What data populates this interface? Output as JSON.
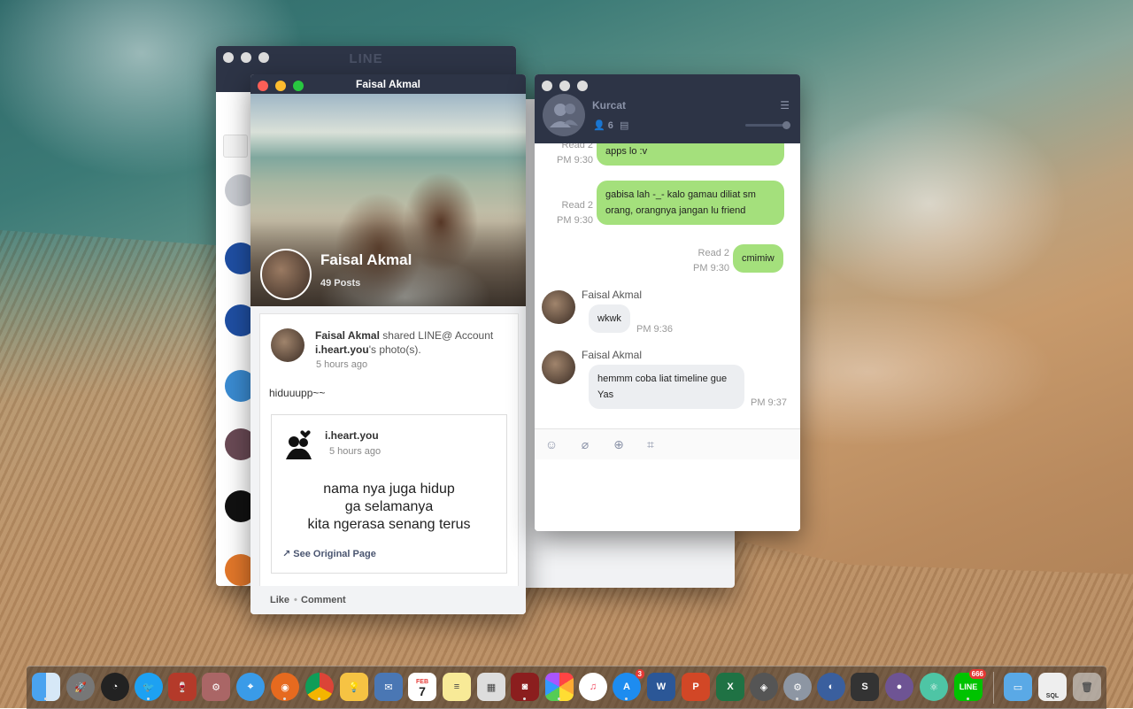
{
  "line_window": {
    "title": "LINE"
  },
  "profile_window": {
    "title": "Faisal Akmal",
    "name": "Faisal Akmal",
    "posts": "49 Posts",
    "post": {
      "author": "Faisal Akmal",
      "action": "shared LINE@ Account",
      "account": "i.heart.you",
      "suffix": "'s photo(s).",
      "time": "5 hours ago",
      "text": "hiduuupp~~",
      "shared": {
        "name": "i.heart.you",
        "time": "5 hours ago",
        "line1": "nama nya juga hidup",
        "line2": "ga selamanya",
        "line3": "kita ngerasa senang terus",
        "see_original": "See Original Page"
      },
      "like": "Like",
      "comment": "Comment"
    }
  },
  "chat_window": {
    "title": "Kurcat",
    "member_count": "6",
    "messages": [
      {
        "from": "me",
        "text": "apps lo :v",
        "read": "Read 2",
        "time": "PM 9:30"
      },
      {
        "from": "me",
        "text1": "gabisa lah -_- kalo gamau diliat sm",
        "text2": "orang, orangnya jangan lu friend",
        "read": "Read 2",
        "time": "PM 9:30"
      },
      {
        "from": "me",
        "text": "cmimiw",
        "read": "Read 2",
        "time": "PM 9:30"
      },
      {
        "from": "them",
        "sender": "Faisal Akmal",
        "text": "wkwk",
        "time": "PM 9:36"
      },
      {
        "from": "them",
        "sender": "Faisal Akmal",
        "text1": "hemmm coba liat timeline gue",
        "text2": "Yas",
        "time": "PM 9:37"
      }
    ]
  },
  "dock": {
    "calendar_month": "FEB",
    "calendar_day": "7",
    "appstore_badge": "3",
    "line_badge": "666",
    "line_label": "LINE",
    "word_label": "W",
    "powerpoint_label": "P",
    "excel_label": "X",
    "sublime_label": "S",
    "sql_label": "SQL"
  },
  "colors": {
    "line_dark": "#2d3446",
    "bubble_green": "#a4e07c",
    "bubble_gray": "#eceef1"
  }
}
